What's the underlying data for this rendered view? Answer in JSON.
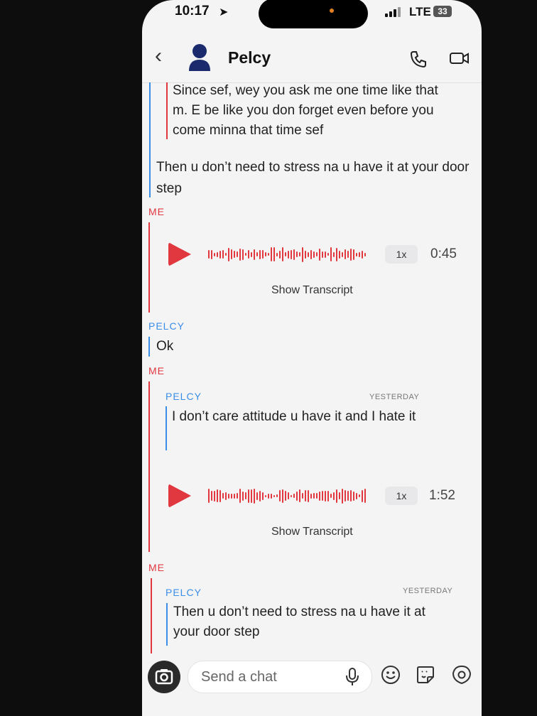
{
  "status": {
    "time": "10:17",
    "network": "LTE",
    "battery": "33"
  },
  "header": {
    "contact_name": "Pelcy"
  },
  "messages": {
    "quoted_top": "Since sef, wey you ask me one time like that m. E be like you don forget even before you come minna that time sef",
    "pelcy_reply_1": "Then u don’t need to stress na u have it at your door step",
    "me_label_1": "ME",
    "voice_1": {
      "speed": "1x",
      "duration": "0:45",
      "transcript_label": "Show Transcript"
    },
    "pelcy_label": "PELCY",
    "pelcy_ok": "Ok",
    "me_label_2": "ME",
    "quote_2": {
      "sender": "PELCY",
      "when": "YESTERDAY",
      "text": "I don’t care attitude u have it and I hate it"
    },
    "voice_2": {
      "speed": "1x",
      "duration": "1:52",
      "transcript_label": "Show Transcript"
    },
    "me_label_3": "ME",
    "quote_3": {
      "sender": "PELCY",
      "when": "YESTERDAY",
      "text": "Then u don’t need to stress na u have it at your door step"
    }
  },
  "composer": {
    "placeholder": "Send a chat"
  },
  "icons": {
    "back": "chevron-left-icon",
    "avatar": "bitmoji-avatar",
    "call": "phone-icon",
    "video": "video-camera-icon",
    "camera": "camera-icon",
    "mic": "microphone-icon",
    "emoji": "smiley-icon",
    "sticker": "sticker-icon",
    "lens": "lens-icon"
  },
  "colors": {
    "me": "#e0383e",
    "friend": "#3a8ee6",
    "background": "#f4f4f5"
  }
}
